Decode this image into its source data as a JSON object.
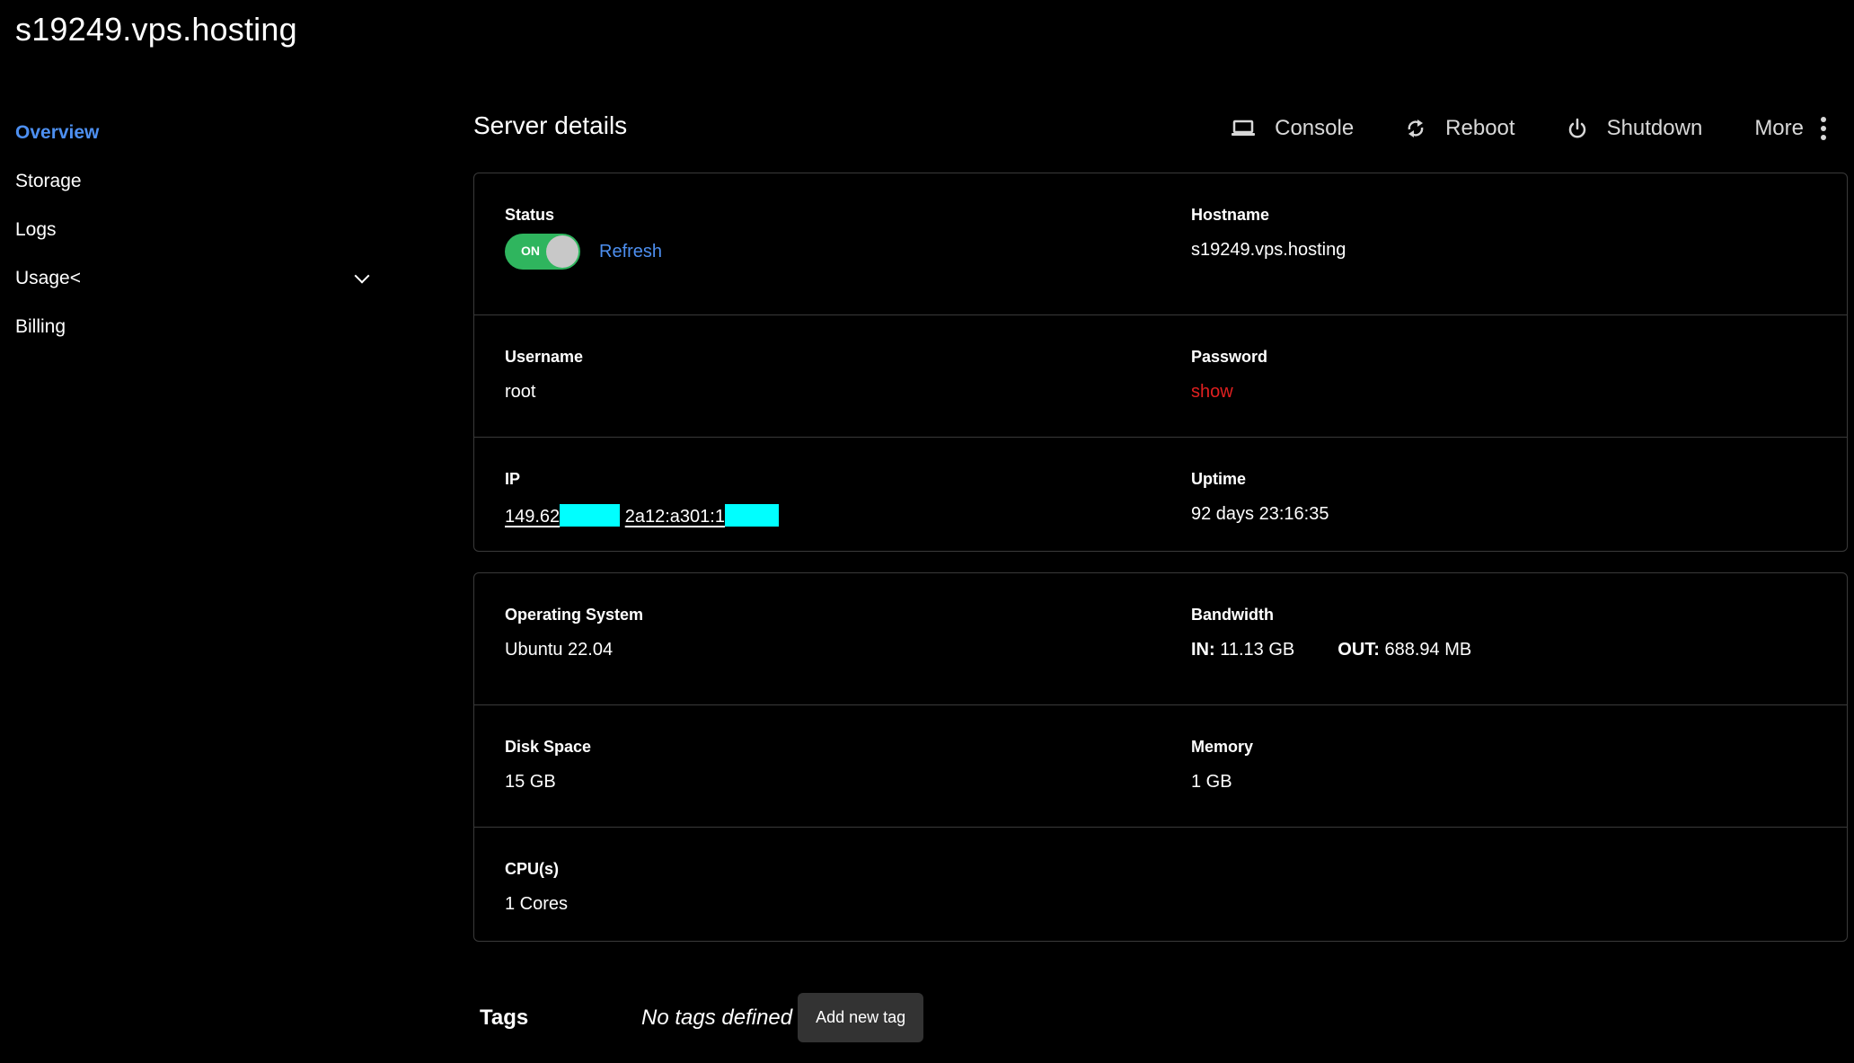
{
  "header": {
    "title": "s19249.vps.hosting"
  },
  "sidebar": {
    "items": [
      {
        "label": "Overview",
        "active": true
      },
      {
        "label": "Storage"
      },
      {
        "label": "Logs"
      },
      {
        "label": "Usage<",
        "has_dropdown": true
      },
      {
        "label": "Billing"
      }
    ]
  },
  "main": {
    "section_title": "Server details",
    "toolbar": {
      "console_label": "Console",
      "reboot_label": "Reboot",
      "shutdown_label": "Shutdown",
      "more_label": "More"
    },
    "details": {
      "status": {
        "label": "Status",
        "toggle_label": "ON",
        "toggle_on": true,
        "refresh_label": "Refresh"
      },
      "hostname": {
        "label": "Hostname",
        "value": "s19249.vps.hosting"
      },
      "username": {
        "label": "Username",
        "value": "root"
      },
      "password": {
        "label": "Password",
        "action_label": "show"
      },
      "ip": {
        "label": "IP",
        "ipv4_prefix": "149.62",
        "ipv6_prefix": "2a12:a301:1"
      },
      "uptime": {
        "label": "Uptime",
        "value": "92 days 23:16:35"
      }
    },
    "specs": {
      "os": {
        "label": "Operating System",
        "value": "Ubuntu 22.04"
      },
      "bandwidth": {
        "label": "Bandwidth",
        "in_key": "IN:",
        "in_value": "11.13 GB",
        "out_key": "OUT:",
        "out_value": "688.94 MB"
      },
      "disk": {
        "label": "Disk Space",
        "value": "15 GB"
      },
      "memory": {
        "label": "Memory",
        "value": "1 GB"
      },
      "cpu": {
        "label": "CPU(s)",
        "value": "1 Cores"
      }
    },
    "tags": {
      "label": "Tags",
      "empty_text": "No tags defined",
      "add_button_label": "Add new tag"
    }
  },
  "colors": {
    "background": "#000000",
    "accent": "#4d8ff0",
    "toggle_on": "#2fb55e",
    "danger": "#e02020",
    "redaction": "#00ffff"
  },
  "icons": [
    "laptop-icon",
    "refresh-icon",
    "power-icon",
    "vertical-dots-icon",
    "chevron-down-icon"
  ]
}
